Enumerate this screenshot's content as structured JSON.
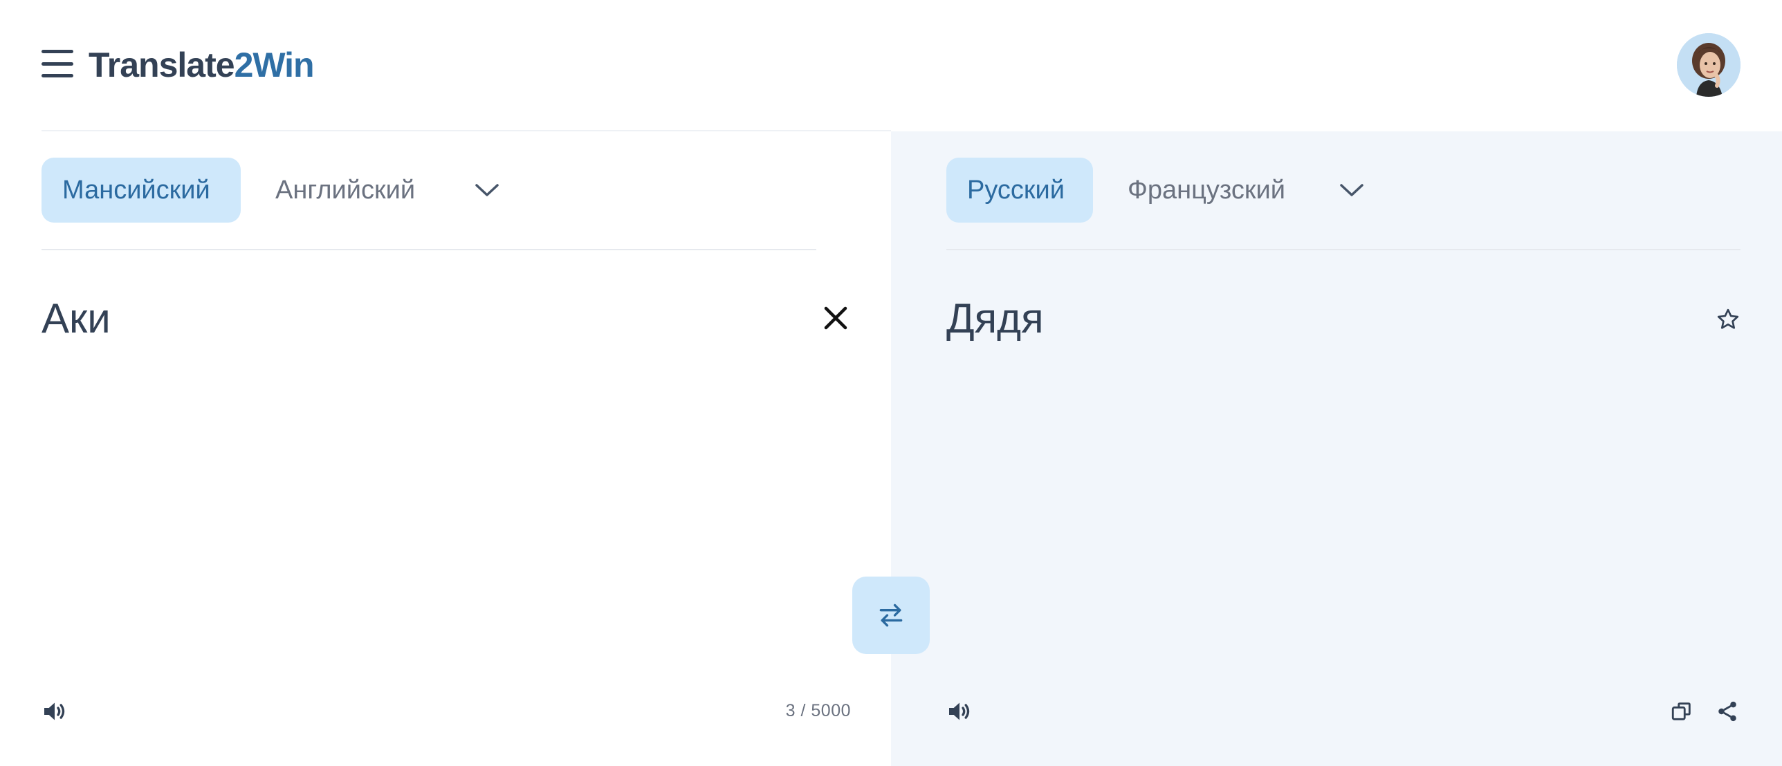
{
  "header": {
    "logo_main": "Translate",
    "logo_accent": "2Win"
  },
  "source": {
    "tabs": [
      {
        "label": "Мансийский",
        "active": true
      },
      {
        "label": "Английский",
        "active": false
      }
    ],
    "text": "Аки",
    "char_count": "3 / 5000"
  },
  "target": {
    "tabs": [
      {
        "label": "Русский",
        "active": true
      },
      {
        "label": "Французский",
        "active": false
      }
    ],
    "text": "Дядя"
  },
  "icons": {
    "menu": "hamburger-menu-icon",
    "avatar": "user-avatar",
    "dropdown": "chevron-down-icon",
    "clear": "close-icon",
    "swap": "swap-arrows-icon",
    "speaker": "speaker-icon",
    "star": "star-outline-icon",
    "copy": "copy-icon",
    "share": "share-icon"
  },
  "colors": {
    "accent": "#2f6fa5",
    "chip_active_bg": "#cfe8fb",
    "right_pane_bg": "#f2f6fb",
    "text_primary": "#334155",
    "text_muted": "#6b7280"
  }
}
